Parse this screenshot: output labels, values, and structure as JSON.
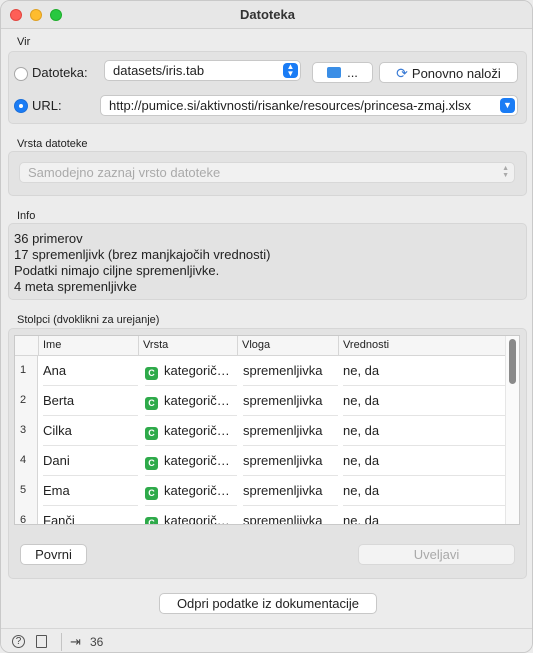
{
  "window": {
    "title": "Datoteka"
  },
  "source": {
    "section_label": "Vir",
    "file_radio_label": "Datoteka:",
    "file_value": "datasets/iris.tab",
    "browse_label": "...",
    "reload_label": "Ponovno naloži",
    "url_radio_label": "URL:",
    "url_value": "http://pumice.si/aktivnosti/risanke/resources/princesa-zmaj.xlsx",
    "selected": "URL"
  },
  "file_type": {
    "section_label": "Vrsta datoteke",
    "value": "Samodejno zaznaj vrsto datoteke"
  },
  "info": {
    "section_label": "Info",
    "lines": [
      "36 primerov",
      "17 spremenljivk (brez manjkajočih vrednosti)",
      "Podatki nimajo ciljne spremenljivke.",
      "4 meta spremenljivke"
    ]
  },
  "columns": {
    "section_label": "Stolpci (dvoklikni za urejanje)",
    "headers": [
      "Ime",
      "Vrsta",
      "Vloga",
      "Vrednosti"
    ],
    "rows": [
      {
        "n": "1",
        "name": "Ana",
        "type": "kategorič…",
        "role": "spremenljivka",
        "values": "ne, da"
      },
      {
        "n": "2",
        "name": "Berta",
        "type": "kategorič…",
        "role": "spremenljivka",
        "values": "ne, da"
      },
      {
        "n": "3",
        "name": "Cilka",
        "type": "kategorič…",
        "role": "spremenljivka",
        "values": "ne, da"
      },
      {
        "n": "4",
        "name": "Dani",
        "type": "kategorič…",
        "role": "spremenljivka",
        "values": "ne, da"
      },
      {
        "n": "5",
        "name": "Ema",
        "type": "kategorič…",
        "role": "spremenljivka",
        "values": "ne, da"
      },
      {
        "n": "6",
        "name": "Fanči",
        "type": "kategorič…",
        "role": "spremenljivka",
        "values": "ne, da"
      }
    ],
    "type_icon_letter": "C",
    "reset_label": "Povrni",
    "apply_label": "Uveljavi"
  },
  "docs_button_label": "Odpri podatke iz dokumentacije",
  "status": {
    "output_count": "36"
  },
  "colors": {
    "accent": "#1a7cf5",
    "categorical": "#2eaa4a"
  }
}
